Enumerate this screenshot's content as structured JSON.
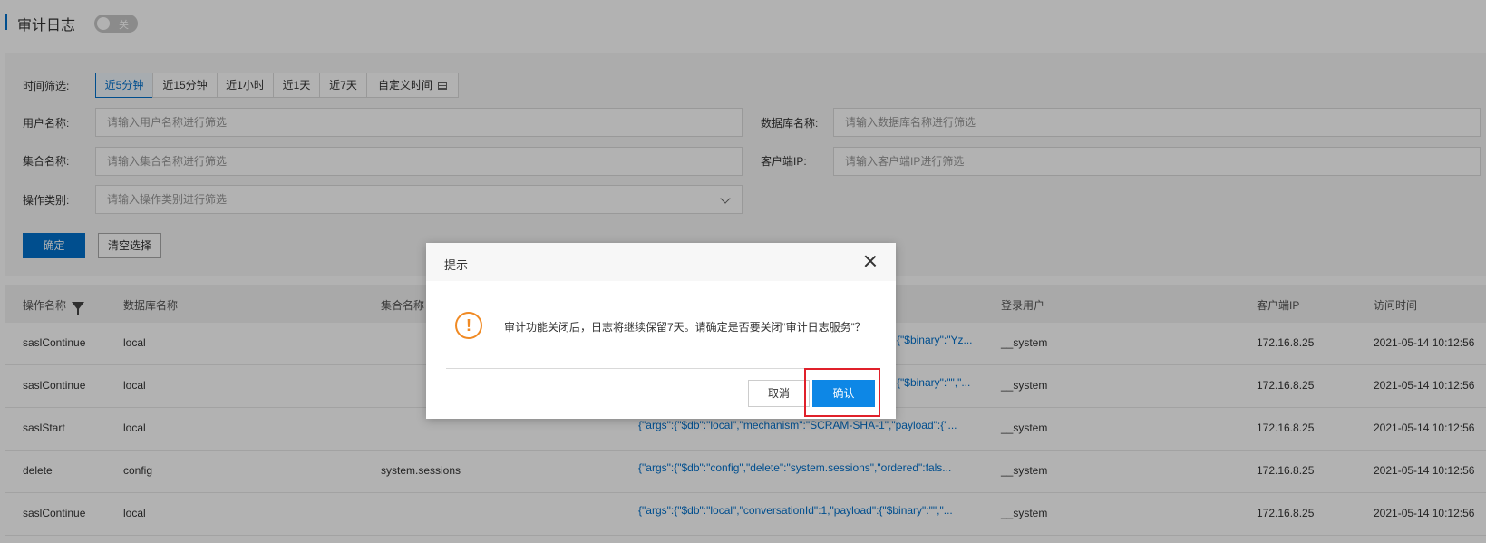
{
  "header": {
    "title": "审计日志",
    "toggle_label": "关"
  },
  "filters": {
    "time_label": "时间筛选:",
    "time_options": [
      "近5分钟",
      "近15分钟",
      "近1小时",
      "近1天",
      "近7天",
      "自定义时间"
    ],
    "user_label": "用户名称:",
    "user_placeholder": "请输入用户名称进行筛选",
    "db_label": "数据库名称:",
    "db_placeholder": "请输入数据库名称进行筛选",
    "collection_label": "集合名称:",
    "collection_placeholder": "请输入集合名称进行筛选",
    "client_ip_label": "客户端IP:",
    "client_ip_placeholder": "请输入客户端IP进行筛选",
    "op_type_label": "操作类别:",
    "op_type_placeholder": "请输入操作类别进行筛选",
    "confirm_label": "确定",
    "clear_label": "清空选择"
  },
  "table": {
    "columns": [
      "操作名称",
      "数据库名称",
      "集合名称",
      "登录用户",
      "客户端IP",
      "访问时间"
    ],
    "rows": [
      {
        "op": "saslContinue",
        "db": "local",
        "coll": "",
        "params": "{\"$binary\":\"Yz...",
        "user": "__system",
        "ip": "172.16.8.25",
        "time": "2021-05-14 10:12:56"
      },
      {
        "op": "saslContinue",
        "db": "local",
        "coll": "",
        "params": "{\"$binary\":\"\",\"...",
        "user": "__system",
        "ip": "172.16.8.25",
        "time": "2021-05-14 10:12:56"
      },
      {
        "op": "saslStart",
        "db": "local",
        "coll": "",
        "params": "{\"args\":{\"$db\":\"local\",\"mechanism\":\"SCRAM-SHA-1\",\"payload\":{\"...",
        "user": "__system",
        "ip": "172.16.8.25",
        "time": "2021-05-14 10:12:56"
      },
      {
        "op": "delete",
        "db": "config",
        "coll": "system.sessions",
        "params": "{\"args\":{\"$db\":\"config\",\"delete\":\"system.sessions\",\"ordered\":fals...",
        "user": "__system",
        "ip": "172.16.8.25",
        "time": "2021-05-14 10:12:56"
      },
      {
        "op": "saslContinue",
        "db": "local",
        "coll": "",
        "params": "{\"args\":{\"$db\":\"local\",\"conversationId\":1,\"payload\":{\"$binary\":\"\",\"...",
        "user": "__system",
        "ip": "172.16.8.25",
        "time": "2021-05-14 10:12:56"
      }
    ]
  },
  "dialog": {
    "title": "提示",
    "message": "审计功能关闭后，日志将继续保留7天。请确定是否要关闭“审计日志服务”？",
    "cancel_label": "取消",
    "ok_label": "确认"
  },
  "colors": {
    "primary": "#0070cc",
    "confirm_button": "#0d87e6",
    "warning": "#f08a24",
    "highlight": "#e0202a"
  }
}
